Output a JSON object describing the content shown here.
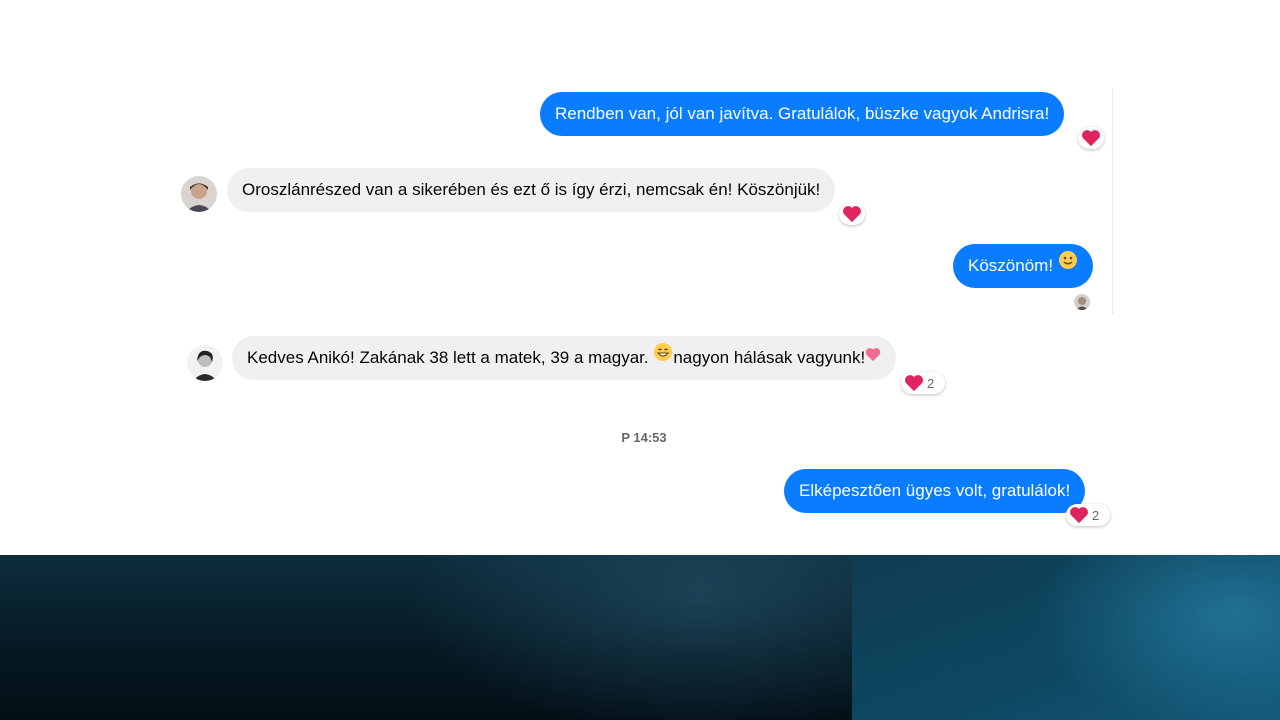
{
  "messages": [
    {
      "direction": "out",
      "text": "Rendben van, jól van javítva. Gratulálok, büszke vagyok Andrisra!",
      "reaction": {
        "icon": "heart-icon",
        "count": ""
      }
    },
    {
      "direction": "in",
      "text": "Oroszlánrészed van a sikerében és ezt ő is így érzi, nemcsak én! Köszönjük!",
      "reaction": {
        "icon": "heart-icon",
        "count": ""
      }
    },
    {
      "direction": "out",
      "text": "Köszönöm!",
      "emoji": "slightly-smiling-face-icon",
      "seen": true
    },
    {
      "direction": "in",
      "text_before": "Kedves Anikó! Zakának 38 lett a matek, 39 a magyar. ",
      "emoji_mid": "grinning-face-icon",
      "text_after": "nagyon hálásak vagyunk!",
      "emoji_end": "heart-icon",
      "reaction": {
        "icon": "heart-icon",
        "count": "2"
      }
    },
    {
      "direction": "out",
      "text": "Elképesztően ügyes volt, gratulálok!",
      "reaction": {
        "icon": "heart-icon",
        "count": "2"
      }
    }
  ],
  "timestamp": "P 14:53",
  "colors": {
    "outgoing_bubble": "#0a7cff",
    "incoming_bubble": "#f0f0f0",
    "heart": "#e0245e"
  }
}
